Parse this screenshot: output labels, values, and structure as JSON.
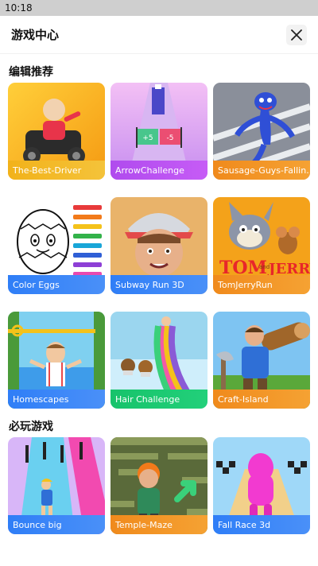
{
  "status_bar": {
    "time": "10:18"
  },
  "header": {
    "title": "游戏中心"
  },
  "sections": [
    {
      "title": "编辑推荐",
      "games": [
        {
          "name": "The-Best-Driver"
        },
        {
          "name": "ArrowChallenge"
        },
        {
          "name": "Sausage-Guys-Fallin..."
        },
        {
          "name": "Color Eggs"
        },
        {
          "name": "Subway Run 3D"
        },
        {
          "name": "TomJerryRun"
        },
        {
          "name": "Homescapes"
        },
        {
          "name": "Hair Challenge"
        },
        {
          "name": "Craft-Island"
        }
      ]
    },
    {
      "title": "必玩游戏",
      "games": [
        {
          "name": "Bounce big"
        },
        {
          "name": "Temple-Maze"
        },
        {
          "name": "Fall Race 3d"
        }
      ]
    }
  ],
  "thumbnail_art": {
    "arrow_gates": [
      "+5",
      "-5"
    ],
    "logo_tom": "TOM",
    "logo_and": "and",
    "logo_jerry": "JERRY"
  }
}
